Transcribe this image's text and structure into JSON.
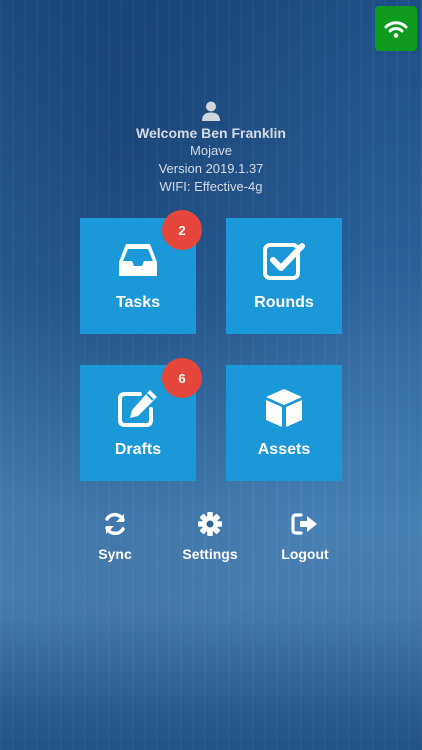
{
  "status": {
    "connection_icon": "wifi-icon",
    "connection_color": "#0f9b1e"
  },
  "user": {
    "welcome": "Welcome Ben Franklin",
    "site": "Mojave",
    "version": "Version 2019.1.37",
    "wifi": "WIFI: Effective-4g"
  },
  "tiles": [
    {
      "label": "Tasks",
      "icon": "inbox-icon",
      "badge": "2"
    },
    {
      "label": "Rounds",
      "icon": "checkbox-icon"
    },
    {
      "label": "Drafts",
      "icon": "edit-icon",
      "badge": "6"
    },
    {
      "label": "Assets",
      "icon": "cube-icon"
    }
  ],
  "actions": [
    {
      "label": "Sync",
      "icon": "sync-icon"
    },
    {
      "label": "Settings",
      "icon": "gear-icon"
    },
    {
      "label": "Logout",
      "icon": "logout-icon"
    }
  ],
  "colors": {
    "tile": "#1a98d8",
    "badge": "#e5473d"
  }
}
